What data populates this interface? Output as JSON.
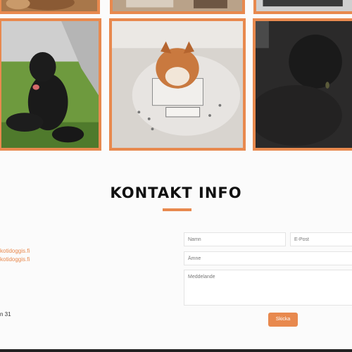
{
  "gallery": {
    "top_row": [
      {
        "alt": "dog-photo-top-left"
      },
      {
        "alt": "photo-top-center"
      },
      {
        "alt": "photo-top-right"
      }
    ],
    "bottom_row": [
      {
        "alt": "black-dog-photo"
      },
      {
        "alt": "cat-in-box-photo"
      },
      {
        "alt": "black-cat-photo"
      }
    ]
  },
  "contact": {
    "heading": "KONTAKT INFO",
    "email_1": "kotidoggis.fi",
    "email_2": "kotidoggis.fi",
    "address_fragment": "n 31"
  },
  "form": {
    "name_placeholder": "Namn",
    "email_placeholder": "E-Post",
    "subject_placeholder": "Ämne",
    "message_placeholder": "Meddelande",
    "submit_label": "Skicka"
  },
  "colors": {
    "accent": "#e8894e",
    "heading": "#111111",
    "background": "#fbfbfb"
  }
}
